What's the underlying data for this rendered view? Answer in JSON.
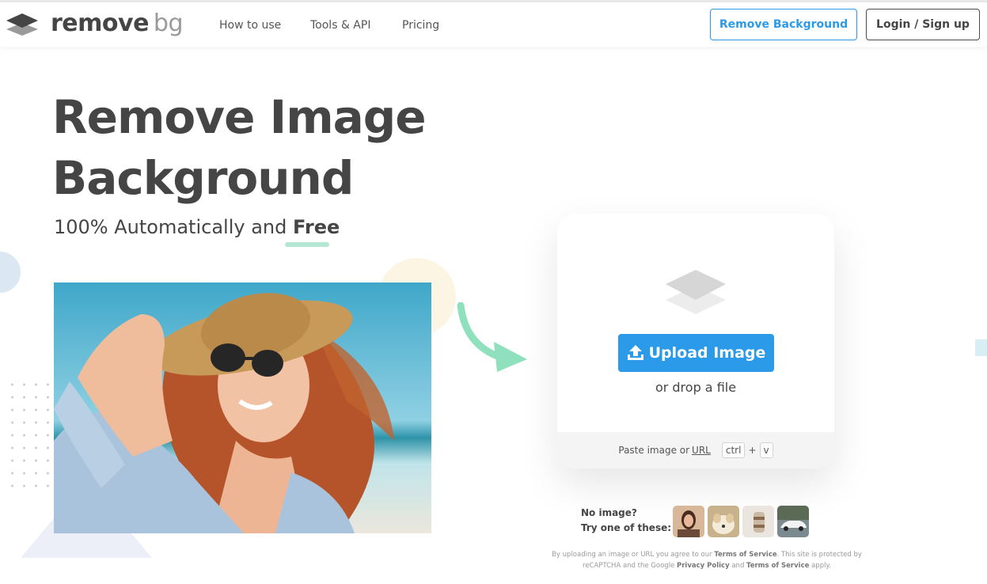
{
  "header": {
    "logo_word": "remove",
    "logo_suffix": "bg",
    "nav": [
      "How to use",
      "Tools & API",
      "Pricing"
    ],
    "remove_background_label": "Remove Background",
    "login_label": "Login / Sign up"
  },
  "hero": {
    "title_line1": "Remove Image",
    "title_line2": "Background",
    "subtitle_prefix": "100% Automatically and",
    "subtitle_emphasis": "Free"
  },
  "upload": {
    "button_label": "Upload Image",
    "drop_text": "or drop a file",
    "paste_prefix": "Paste image or",
    "url_label": "URL",
    "key_ctrl": "ctrl",
    "key_plus": "+",
    "key_v": "v"
  },
  "samples": {
    "line1": "No image?",
    "line2": "Try one of these:",
    "items": [
      "woman-sample",
      "dog-sample",
      "food-sample",
      "car-sample"
    ]
  },
  "terms": {
    "t1": "By uploading an image or URL you agree to our",
    "tos1": "Terms of Service",
    "t2": ". This site is protected by reCAPTCHA and the Google",
    "privacy": "Privacy Policy",
    "t3": "and",
    "tos2": "Terms of Service",
    "t4": "apply."
  },
  "colors": {
    "accent_blue": "#2b9ae8",
    "text_dark": "#454545",
    "mint": "#a8e6cf"
  }
}
